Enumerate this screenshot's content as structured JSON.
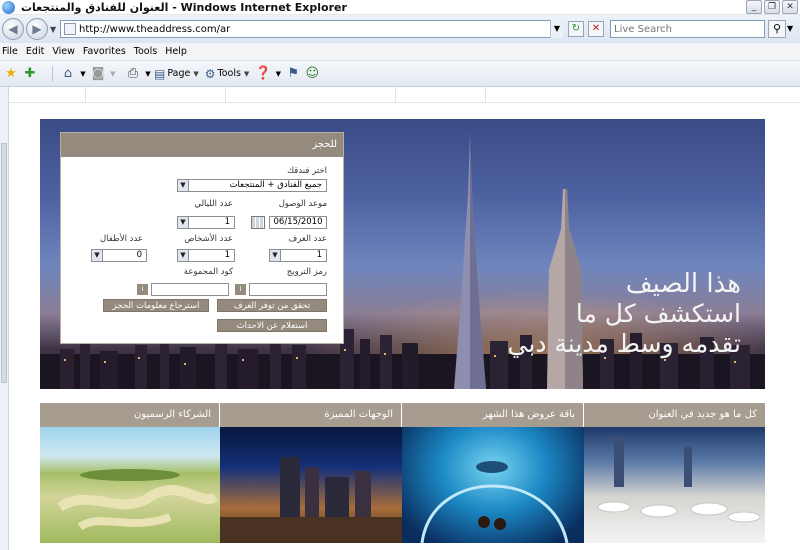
{
  "window": {
    "title": "العنوان للفنادق والمنتجعات - Windows Internet Explorer",
    "controls": [
      "_",
      "❐",
      "✕"
    ]
  },
  "address_bar": {
    "url": "http://www.theaddress.com/ar",
    "search_placeholder": "Live Search"
  },
  "menu": [
    "File",
    "Edit",
    "View",
    "Favorites",
    "Tools",
    "Help"
  ],
  "toolbar": {
    "page_label": "Page",
    "tools_label": "Tools"
  },
  "booking": {
    "header": "للحجز",
    "hotel_label": "اختر فندقك",
    "hotel_value": "جميع الفنادق + المنتجعات",
    "arrival_label": "موعد الوصول",
    "arrival_value": "06/15/2010",
    "nights_label": "عدد الليالي",
    "nights_value": "1",
    "rooms_label": "عدد الغرف",
    "rooms_value": "1",
    "persons_label": "عدد الأشخاص",
    "persons_value": "1",
    "children_label": "عدد الأطفال",
    "children_value": "0",
    "promo_label": "رمز الترويج",
    "group_label": "كود المجموعة",
    "promo_info": "i",
    "group_info": "i",
    "check_button": "تحقق من توفر الغرف",
    "retrieve_button": "استرجاع معلومات الحجز",
    "events_button": "استعلام عن الاحداث"
  },
  "hero": {
    "line1": "هذا الصيف",
    "line2": "استكشف كل ما",
    "line3": "تقدمه وسط مدينة دبي"
  },
  "sections": [
    {
      "title": "كل ما هو جديد في العنوان",
      "image": "dining-terrace"
    },
    {
      "title": "باقة عروض هذا الشهر",
      "image": "aquarium-tunnel"
    },
    {
      "title": "الوجهات  المميزة",
      "image": "night-city"
    },
    {
      "title": "الشركاء الرسميون",
      "image": "golf-course"
    }
  ],
  "colors": {
    "panel_header": "#958a7e",
    "section_header": "#a69c90"
  }
}
